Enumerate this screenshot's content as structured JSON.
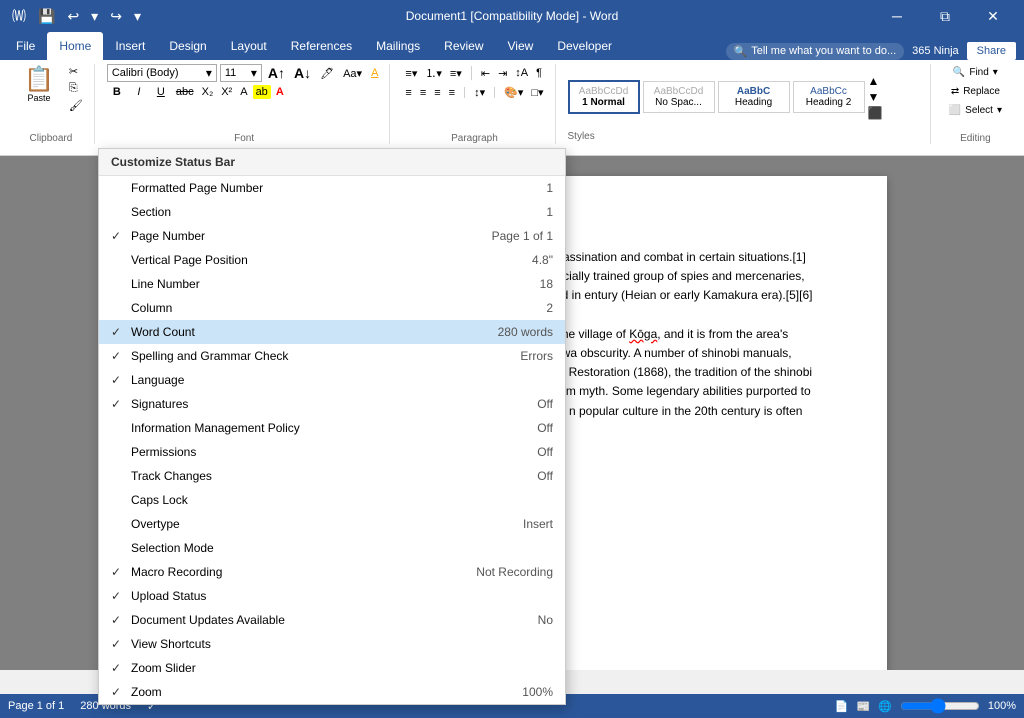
{
  "titlebar": {
    "title": "Document1 [Compatibility Mode] - Word",
    "quick_access": [
      "save",
      "undo",
      "redo",
      "more"
    ],
    "controls": [
      "minimize",
      "restore",
      "close"
    ]
  },
  "ribbon": {
    "tabs": [
      "File",
      "Home",
      "Insert",
      "Design",
      "Layout",
      "References",
      "Mailings",
      "Review",
      "View",
      "Developer"
    ],
    "active_tab": "Home",
    "tell_me": "Tell me what you want to do...",
    "user": "365 Ninja",
    "share": "Share",
    "clipboard_group": "Clipboard",
    "font_group": "Font",
    "paragraph_group": "Paragraph",
    "styles_group": "Styles",
    "editing_group": "Editing",
    "font_name": "Calibri (Body)",
    "font_size": "11",
    "styles": [
      {
        "id": "normal",
        "label": "1 Normal",
        "sublabel": "Normal",
        "active": true
      },
      {
        "id": "nospace",
        "label": "AaBbCcDc",
        "sublabel": "No Spac..."
      },
      {
        "id": "h1",
        "label": "AaBbC",
        "sublabel": "Heading 1"
      },
      {
        "id": "h2",
        "label": "AaBbCc",
        "sublabel": "Heading 2"
      }
    ],
    "select_label": "Select -",
    "heading_label": "Heading",
    "normal_label": "1 Normal",
    "find_label": "Find",
    "replace_label": "Replace",
    "select_label2": "Select"
  },
  "context_menu": {
    "title": "Customize Status Bar",
    "items": [
      {
        "id": "formatted-page-number",
        "label": "Formatted Page Number",
        "value": "1",
        "checked": false
      },
      {
        "id": "section",
        "label": "Section",
        "value": "1",
        "checked": false
      },
      {
        "id": "page-number",
        "label": "Page Number",
        "value": "Page 1 of 1",
        "checked": true
      },
      {
        "id": "vertical-page-position",
        "label": "Vertical Page Position",
        "value": "4.8\"",
        "checked": false
      },
      {
        "id": "line-number",
        "label": "Line Number",
        "value": "18",
        "checked": false
      },
      {
        "id": "column",
        "label": "Column",
        "value": "2",
        "checked": false
      },
      {
        "id": "word-count",
        "label": "Word Count",
        "value": "280 words",
        "checked": true,
        "highlighted": true
      },
      {
        "id": "spelling-grammar",
        "label": "Spelling and Grammar Check",
        "value": "Errors",
        "checked": true
      },
      {
        "id": "language",
        "label": "Language",
        "value": "",
        "checked": true
      },
      {
        "id": "signatures",
        "label": "Signatures",
        "value": "Off",
        "checked": true
      },
      {
        "id": "info-mgmt-policy",
        "label": "Information Management Policy",
        "value": "Off",
        "checked": false
      },
      {
        "id": "permissions",
        "label": "Permissions",
        "value": "Off",
        "checked": false
      },
      {
        "id": "track-changes",
        "label": "Track Changes",
        "value": "Off",
        "checked": false
      },
      {
        "id": "caps-lock",
        "label": "Caps Lock",
        "value": "",
        "checked": false
      },
      {
        "id": "overtype",
        "label": "Overtype",
        "value": "Insert",
        "checked": false
      },
      {
        "id": "selection-mode",
        "label": "Selection Mode",
        "value": "",
        "checked": false
      },
      {
        "id": "macro-recording",
        "label": "Macro Recording",
        "value": "Not Recording",
        "checked": true
      },
      {
        "id": "upload-status",
        "label": "Upload Status",
        "value": "",
        "checked": true
      },
      {
        "id": "doc-updates",
        "label": "Document Updates Available",
        "value": "No",
        "checked": true
      },
      {
        "id": "view-shortcuts",
        "label": "View Shortcuts",
        "value": "",
        "checked": true
      },
      {
        "id": "zoom-slider",
        "label": "Zoom Slider",
        "value": "",
        "checked": true
      },
      {
        "id": "zoom",
        "label": "Zoom",
        "value": "100%",
        "checked": true
      }
    ]
  },
  "document": {
    "text": "agent or mercenary in feudal Japan. The functions of the n, assassination and combat in certain situations.[1] Their ninja with the samurai, who observed strict rules about pecially trained group of spies and mercenaries, appeared the 15th century,[3] but antecedents may have existed in entury (Heian or early Kamakura era).[5][6] h centuries), mercenaries and spies for hire became active nd the village of Kōga, and it is from the area's clans that . Following the unification of Japan under the Tokugawa  obscurity. A number of shinobi manuals, often based on the 17th and 18th centuries, most notably the aji Restoration (1868), the tradition of the shinobi had ystery in Japan. Ninja figured prominently in folklore and from myth. Some legendary abilities purported to be in ty, walking on water and control over the natural elements. n popular culture in the 20th century is often based more of the Sengoku period.",
    "koga_word": "Kōga"
  },
  "statusbar": {
    "page": "Page 1 of 1",
    "words": "280 words",
    "language": "√",
    "zoom": "100%"
  }
}
